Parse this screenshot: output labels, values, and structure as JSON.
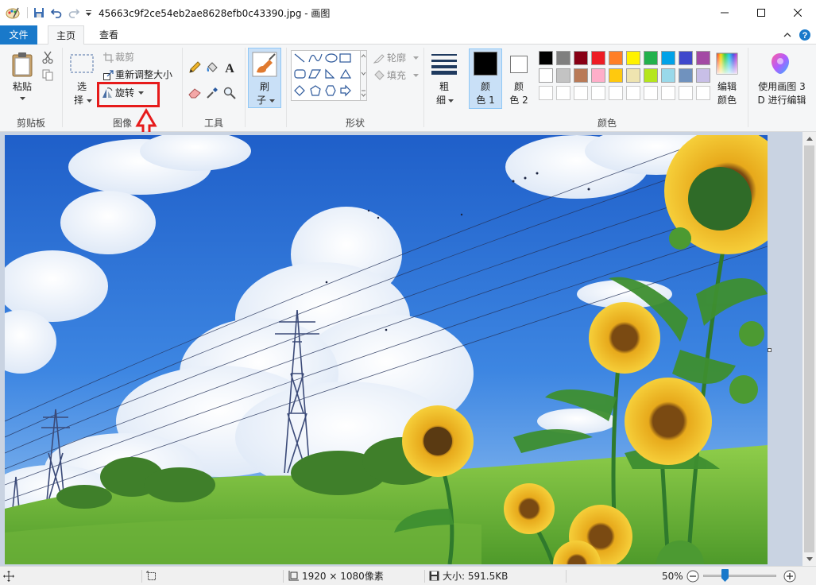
{
  "window": {
    "file_name": "45663c9f2ce54eb2ae8628efb0c43390.jpg",
    "title_separator": " - ",
    "app_name": "画图"
  },
  "tabs": {
    "file": "文件",
    "home": "主页",
    "view": "查看"
  },
  "ribbon": {
    "clipboard": {
      "label": "剪贴板",
      "paste": "粘贴"
    },
    "image": {
      "label": "图像",
      "select_line1": "选",
      "select_line2": "择",
      "crop": "裁剪",
      "resize": "重新调整大小",
      "rotate": "旋转"
    },
    "tools": {
      "label": "工具"
    },
    "brushes": {
      "line1": "刷",
      "line2": "子"
    },
    "shapes": {
      "label": "形状",
      "outline": "轮廓",
      "fill": "填充"
    },
    "size": {
      "line1": "粗",
      "line2": "细"
    },
    "color1": {
      "line1": "颜",
      "line2": "色 1",
      "value": "#000000"
    },
    "color2": {
      "line1": "颜",
      "line2": "色 2",
      "value": "#ffffff"
    },
    "colors": {
      "label": "颜色",
      "row1": [
        "#000000",
        "#7f7f7f",
        "#880015",
        "#ed1c24",
        "#ff7f27",
        "#fff200",
        "#22b14c",
        "#00a2e8",
        "#3f48cc",
        "#a349a4"
      ],
      "row2": [
        "#ffffff",
        "#c3c3c3",
        "#b97a57",
        "#ffaec9",
        "#ffc90e",
        "#efe4b0",
        "#b5e61d",
        "#99d9ea",
        "#7092be",
        "#c8bfe7"
      ],
      "edit_line1": "编辑",
      "edit_line2": "颜色"
    },
    "paint3d": {
      "line1": "使用画图 3",
      "line2": "D 进行编辑"
    }
  },
  "statusbar": {
    "dimensions": "1920 × 1080像素",
    "size": "大小: 591.5KB",
    "zoom": "50%",
    "zoom_level_fraction": 0.5
  }
}
